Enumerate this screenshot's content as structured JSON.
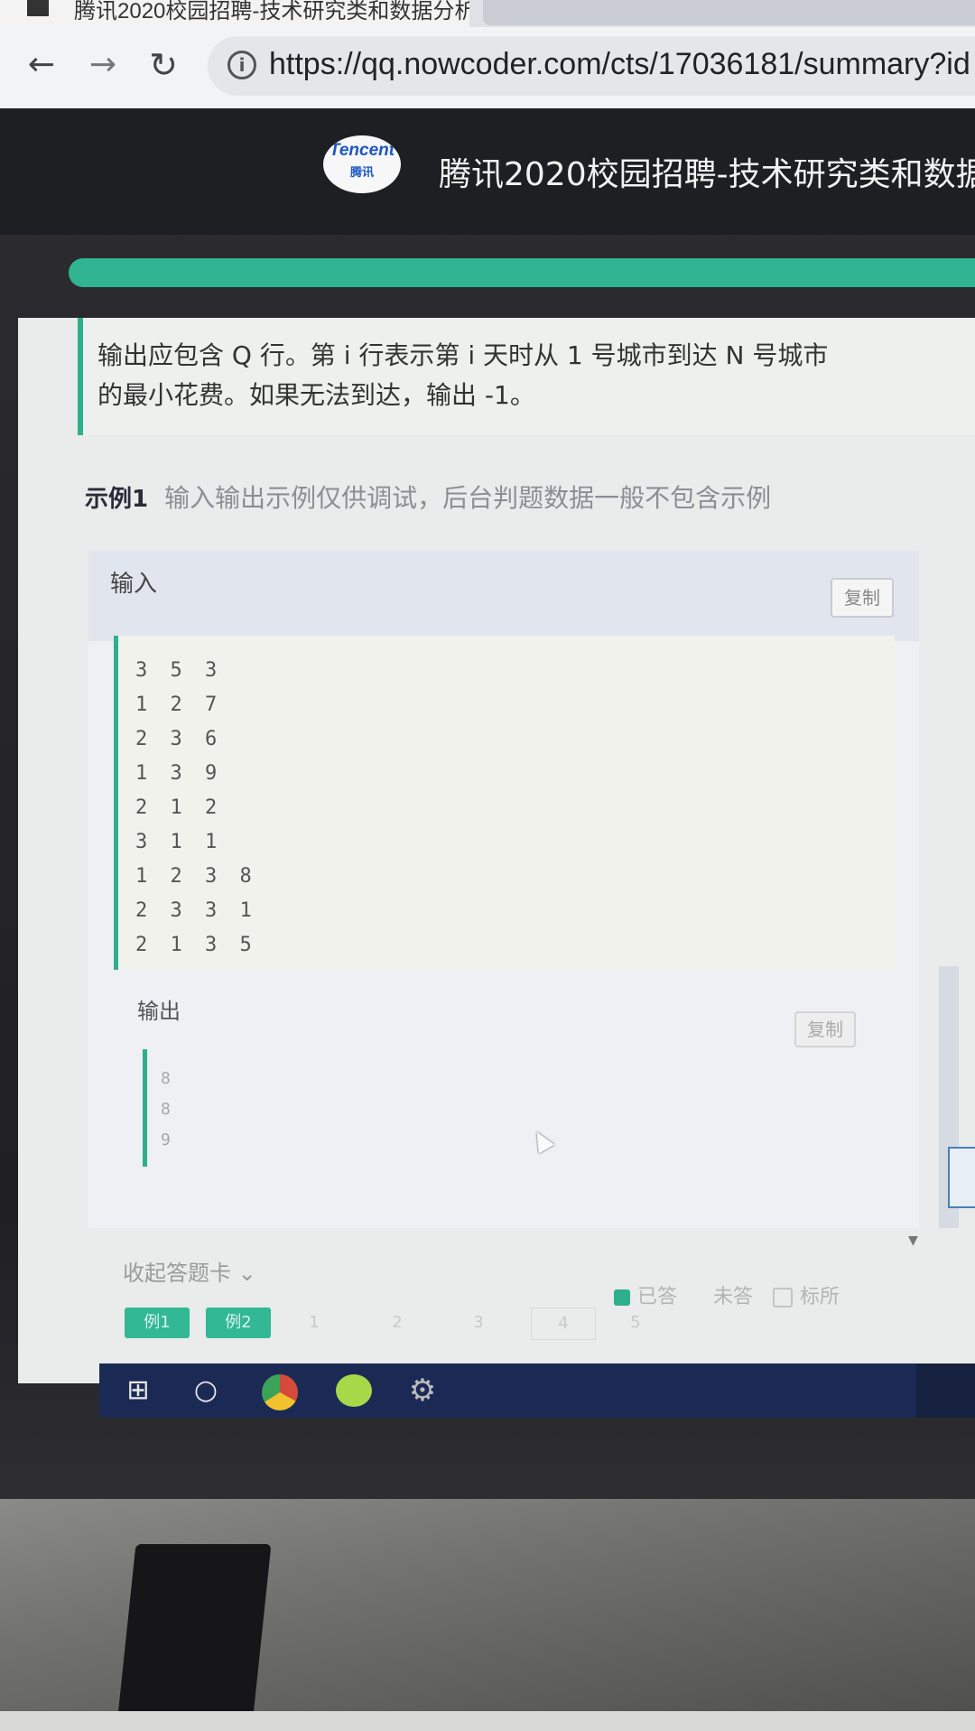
{
  "browser": {
    "tab_title": "腾讯2020校园招聘-技术研究类和数据分析",
    "url": "https://qq.nowcoder.com/cts/17036181/summary?id"
  },
  "header": {
    "logo_text": "Tencent",
    "logo_cn": "腾讯",
    "title": "腾讯2020校园招聘-技术研究类和数据分"
  },
  "problem": {
    "output_desc": "输出应包含 Q 行。第 i 行表示第 i 天时从 1 号城市到达 N 号城市\n的最小花费。如果无法到达，输出 -1。"
  },
  "example": {
    "label": "示例1",
    "note": "输入输出示例仅供调试，后台判题数据一般不包含示例",
    "input_label": "输入",
    "copy_label": "复制",
    "input_lines": [
      "3 5 3",
      "1 2 7",
      "2 3 6",
      "1 3 9",
      "2 1 2",
      "3 1 1",
      "1 2 3 8",
      "2 3 3 1",
      "2 1 3 5"
    ],
    "output_label": "输出",
    "output_lines": [
      "8",
      "8",
      "9"
    ]
  },
  "answer_card": {
    "collapse_label": "收起答题卡 ⌄",
    "legend_answered": "已答",
    "legend_unanswered": "未答",
    "legend_marked": "标所",
    "examples": [
      "例1",
      "例2"
    ],
    "numbers": [
      "1",
      "2",
      "3",
      "4",
      "5"
    ]
  },
  "colors": {
    "accent": "#2fae8f",
    "header_bg": "#1e1f22",
    "taskbar": "#1b2a55"
  }
}
